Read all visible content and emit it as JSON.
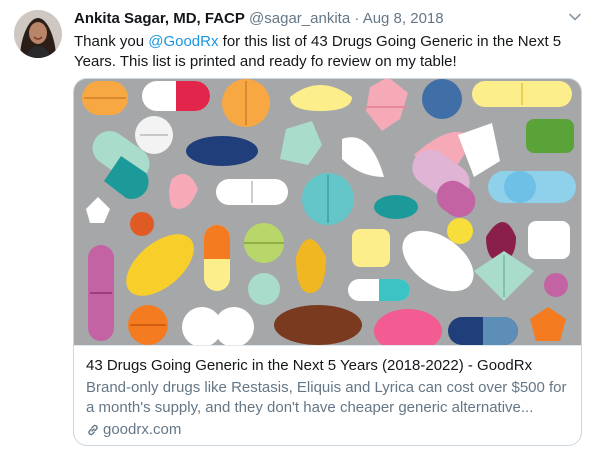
{
  "tweet": {
    "author_name": "Ankita Sagar, MD, FACP",
    "author_handle": "@sagar_ankita",
    "separator": "·",
    "date": "Aug 8, 2018",
    "text_before": "Thank you ",
    "mention": "@GoodRx",
    "text_after": " for this list of 43 Drugs Going Generic in the Next 5 Years. This list is printed and ready fo review on my table!"
  },
  "card": {
    "title": "43 Drugs Going Generic in the Next 5 Years (2018-2022) - GoodRx",
    "description": "Brand-only drugs like Restasis, Eliquis and Lyrica can cost over $500 for a month's supply, and they don't have cheaper generic alternative...",
    "domain": "goodrx.com"
  },
  "colors": {
    "link": "#1b95e0",
    "secondary_text": "#657786",
    "image_background": "#a6a7a8"
  },
  "icons": {
    "avatar": "profile-photo",
    "caret": "chevron-down-icon",
    "link": "link-icon"
  }
}
